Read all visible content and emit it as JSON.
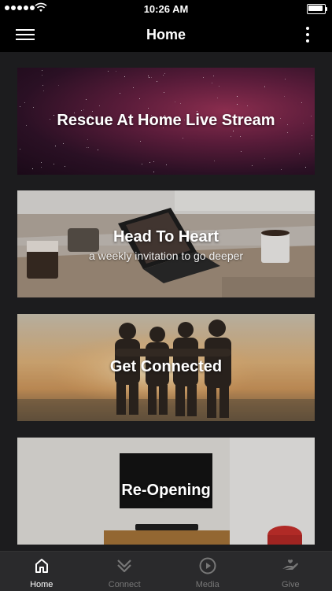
{
  "status_bar": {
    "time": "10:26 AM"
  },
  "header": {
    "title": "Home"
  },
  "cards": [
    {
      "title": "Rescue At Home Live Stream",
      "subtitle": ""
    },
    {
      "title": "Head To Heart",
      "subtitle": "a weekly invitation to go deeper"
    },
    {
      "title": "Get Connected",
      "subtitle": ""
    },
    {
      "title": "Re-Opening",
      "subtitle": ""
    }
  ],
  "tab_bar": {
    "tabs": [
      {
        "label": "Home",
        "icon": "home-icon",
        "active": true
      },
      {
        "label": "Connect",
        "icon": "chevrons-down-icon",
        "active": false
      },
      {
        "label": "Media",
        "icon": "play-circle-icon",
        "active": false
      },
      {
        "label": "Give",
        "icon": "give-hand-icon",
        "active": false
      }
    ]
  },
  "colors": {
    "background": "#1c1c1e",
    "bar_background": "#000000",
    "tab_bar_background": "#2a2a2c",
    "tab_active": "#ffffff",
    "tab_inactive": "#777777"
  }
}
